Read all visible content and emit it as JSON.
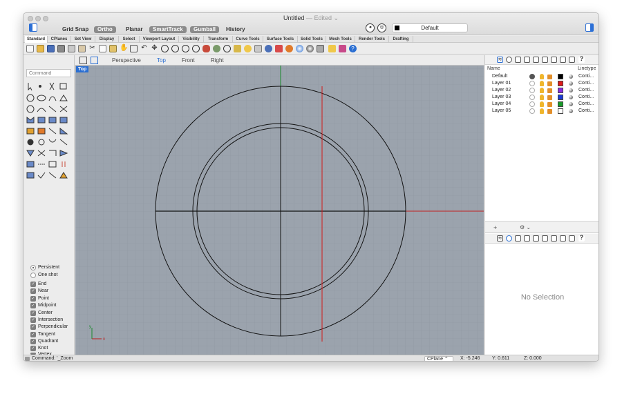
{
  "window": {
    "title": "Untitled",
    "title_suffix": "— Edited ⌄"
  },
  "titlebar": {
    "toggles": [
      {
        "label": "Grid Snap",
        "active": false
      },
      {
        "label": "Ortho",
        "active": true
      },
      {
        "label": "Planar",
        "active": false
      },
      {
        "label": "SmartTrack",
        "active": true
      },
      {
        "label": "Gumball",
        "active": true
      },
      {
        "label": "History",
        "active": false
      }
    ],
    "current_layer": "Default"
  },
  "toolbar_tabs": [
    "Standard",
    "CPlanes",
    "Set View",
    "Display",
    "Select",
    "Viewport Layout",
    "Visibility",
    "Transform",
    "Curve Tools",
    "Surface Tools",
    "Solid Tools",
    "Mesh Tools",
    "Render Tools",
    "Drafting"
  ],
  "command": {
    "placeholder": "Command",
    "last": "Command: '_Zoom"
  },
  "osnap": {
    "modes": [
      {
        "label": "Persistent",
        "selected": true
      },
      {
        "label": "One shot",
        "selected": false
      }
    ],
    "items": [
      "End",
      "Near",
      "Point",
      "Midpoint",
      "Center",
      "Intersection",
      "Perpendicular",
      "Tangent",
      "Quadrant",
      "Knot",
      "Vertex"
    ]
  },
  "viewport": {
    "tabs": [
      "Perspective",
      "Top",
      "Front",
      "Right"
    ],
    "active_tab": "Top",
    "label": "Top",
    "axis_x": "x",
    "axis_y": "y"
  },
  "layers_panel": {
    "col_name": "Name",
    "col_linetype": "Linetype",
    "layers": [
      {
        "name": "Default",
        "color": "#000000",
        "current": true,
        "linetype": "Conti..."
      },
      {
        "name": "Layer 01",
        "color": "#e01a1a",
        "current": false,
        "linetype": "Conti..."
      },
      {
        "name": "Layer 02",
        "color": "#8a2be2",
        "current": false,
        "linetype": "Conti..."
      },
      {
        "name": "Layer 03",
        "color": "#1a3ad6",
        "current": false,
        "linetype": "Conti..."
      },
      {
        "name": "Layer 04",
        "color": "#1a9a2a",
        "current": false,
        "linetype": "Conti..."
      },
      {
        "name": "Layer 05",
        "color": "#ffffff",
        "current": false,
        "linetype": "Conti..."
      }
    ]
  },
  "properties_panel": {
    "empty_text": "No Selection"
  },
  "status": {
    "cplane": "CPlane",
    "x": "X: -5.246",
    "y": "Y: 0.611",
    "z": "Z: 0.000"
  }
}
